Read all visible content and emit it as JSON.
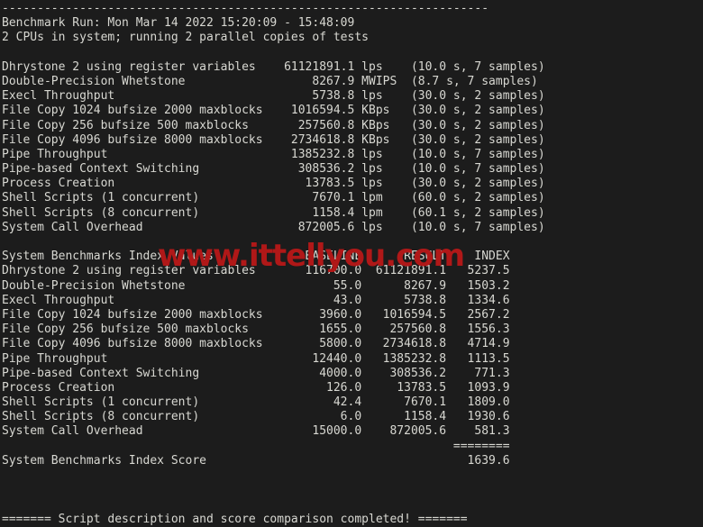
{
  "terminal": {
    "background_color": "#1c1c1c",
    "text_color": "#d8d8d2",
    "rule_top": "---------------------------------------------------------------------",
    "header": {
      "run_line": "Benchmark Run: Mon Mar 14 2022 15:20:09 - 15:48:09",
      "cpu_line": "2 CPUs in system; running 2 parallel copies of tests"
    },
    "results": {
      "rows": [
        {
          "name": "Dhrystone 2 using register variables",
          "value": "61121891.1",
          "unit": "lps",
          "timing": "(10.0 s, 7 samples)"
        },
        {
          "name": "Double-Precision Whetstone",
          "value": "8267.9",
          "unit": "MWIPS",
          "timing": "(8.7 s, 7 samples)"
        },
        {
          "name": "Execl Throughput",
          "value": "5738.8",
          "unit": "lps",
          "timing": "(30.0 s, 2 samples)"
        },
        {
          "name": "File Copy 1024 bufsize 2000 maxblocks",
          "value": "1016594.5",
          "unit": "KBps",
          "timing": "(30.0 s, 2 samples)"
        },
        {
          "name": "File Copy 256 bufsize 500 maxblocks",
          "value": "257560.8",
          "unit": "KBps",
          "timing": "(30.0 s, 2 samples)"
        },
        {
          "name": "File Copy 4096 bufsize 8000 maxblocks",
          "value": "2734618.8",
          "unit": "KBps",
          "timing": "(30.0 s, 2 samples)"
        },
        {
          "name": "Pipe Throughput",
          "value": "1385232.8",
          "unit": "lps",
          "timing": "(10.0 s, 7 samples)"
        },
        {
          "name": "Pipe-based Context Switching",
          "value": "308536.2",
          "unit": "lps",
          "timing": "(10.0 s, 7 samples)"
        },
        {
          "name": "Process Creation",
          "value": "13783.5",
          "unit": "lps",
          "timing": "(30.0 s, 2 samples)"
        },
        {
          "name": "Shell Scripts (1 concurrent)",
          "value": "7670.1",
          "unit": "lpm",
          "timing": "(60.0 s, 2 samples)"
        },
        {
          "name": "Shell Scripts (8 concurrent)",
          "value": "1158.4",
          "unit": "lpm",
          "timing": "(60.1 s, 2 samples)"
        },
        {
          "name": "System Call Overhead",
          "value": "872005.6",
          "unit": "lps",
          "timing": "(10.0 s, 7 samples)"
        }
      ]
    },
    "index_table": {
      "title": "System Benchmarks Index Values",
      "columns": [
        "BASELINE",
        "RESULT",
        "INDEX"
      ],
      "rows": [
        {
          "name": "Dhrystone 2 using register variables",
          "baseline": "116700.0",
          "result": "61121891.1",
          "index": "5237.5"
        },
        {
          "name": "Double-Precision Whetstone",
          "baseline": "55.0",
          "result": "8267.9",
          "index": "1503.2"
        },
        {
          "name": "Execl Throughput",
          "baseline": "43.0",
          "result": "5738.8",
          "index": "1334.6"
        },
        {
          "name": "File Copy 1024 bufsize 2000 maxblocks",
          "baseline": "3960.0",
          "result": "1016594.5",
          "index": "2567.2"
        },
        {
          "name": "File Copy 256 bufsize 500 maxblocks",
          "baseline": "1655.0",
          "result": "257560.8",
          "index": "1556.3"
        },
        {
          "name": "File Copy 4096 bufsize 8000 maxblocks",
          "baseline": "5800.0",
          "result": "2734618.8",
          "index": "4714.9"
        },
        {
          "name": "Pipe Throughput",
          "baseline": "12440.0",
          "result": "1385232.8",
          "index": "1113.5"
        },
        {
          "name": "Pipe-based Context Switching",
          "baseline": "4000.0",
          "result": "308536.2",
          "index": "771.3"
        },
        {
          "name": "Process Creation",
          "baseline": "126.0",
          "result": "13783.5",
          "index": "1093.9"
        },
        {
          "name": "Shell Scripts (1 concurrent)",
          "baseline": "42.4",
          "result": "7670.1",
          "index": "1809.0"
        },
        {
          "name": "Shell Scripts (8 concurrent)",
          "baseline": "6.0",
          "result": "1158.4",
          "index": "1930.6"
        },
        {
          "name": "System Call Overhead",
          "baseline": "15000.0",
          "result": "872005.6",
          "index": "581.3"
        }
      ],
      "separator": "========",
      "score_label": "System Benchmarks Index Score",
      "score_value": "1639.6"
    },
    "footer": {
      "completion_line": "======= Script description and score comparison completed! ======="
    }
  },
  "watermark": {
    "text": "www.ittellyou.com",
    "color": "#b01818"
  }
}
